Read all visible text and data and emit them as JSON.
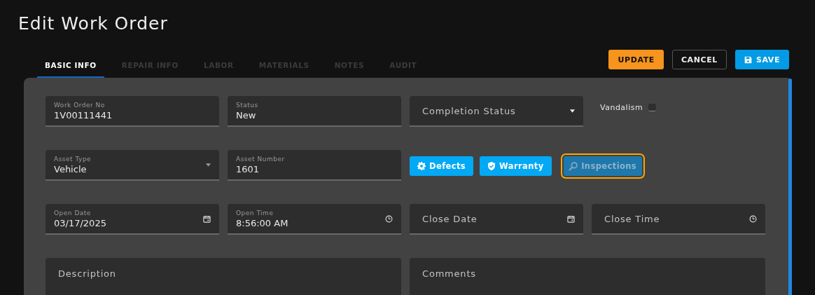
{
  "title": "Edit Work Order",
  "tabs": [
    {
      "label": "BASIC INFO",
      "selected": true
    },
    {
      "label": "REPAIR INFO",
      "selected": false
    },
    {
      "label": "LABOR",
      "selected": false
    },
    {
      "label": "MATERIALS",
      "selected": false
    },
    {
      "label": "NOTES",
      "selected": false
    },
    {
      "label": "AUDIT",
      "selected": false
    }
  ],
  "actions": [
    {
      "label": "UPDATE",
      "kind": "warning"
    },
    {
      "label": "CANCEL",
      "kind": "outline"
    },
    {
      "label": "SAVE",
      "kind": "primary"
    }
  ],
  "rows": [
    {
      "items": [
        {
          "kind": "text",
          "label": "Work Order No",
          "value": "1V00111441"
        },
        {
          "kind": "text",
          "label": "Status",
          "value": "New"
        },
        {
          "kind": "select",
          "placeholder": "Completion Status"
        },
        {
          "kind": "checkbox",
          "label": "Vandalism",
          "checked": false
        }
      ]
    },
    {
      "items": [
        {
          "kind": "select",
          "label": "Asset Type",
          "value": "Vehicle"
        },
        {
          "kind": "text",
          "label": "Asset Number",
          "value": "1601"
        },
        {
          "kind": "buttons",
          "buttons": [
            {
              "label": "Defects",
              "disabled": false,
              "highlighted": false
            },
            {
              "label": "Warranty",
              "disabled": false,
              "highlighted": false
            },
            {
              "label": "Inspections",
              "disabled": true,
              "highlighted": true
            }
          ]
        }
      ]
    },
    {
      "items": [
        {
          "kind": "date",
          "label": "Open Date",
          "value": "03/17/2025"
        },
        {
          "kind": "time",
          "label": "Open Time",
          "value": "8:56:00 AM"
        },
        {
          "kind": "date",
          "placeholder": "Close Date"
        },
        {
          "kind": "time",
          "placeholder": "Close Time"
        }
      ]
    },
    {
      "items": [
        {
          "kind": "area",
          "placeholder": "Description"
        },
        {
          "kind": "area",
          "placeholder": "Comments"
        }
      ]
    }
  ]
}
